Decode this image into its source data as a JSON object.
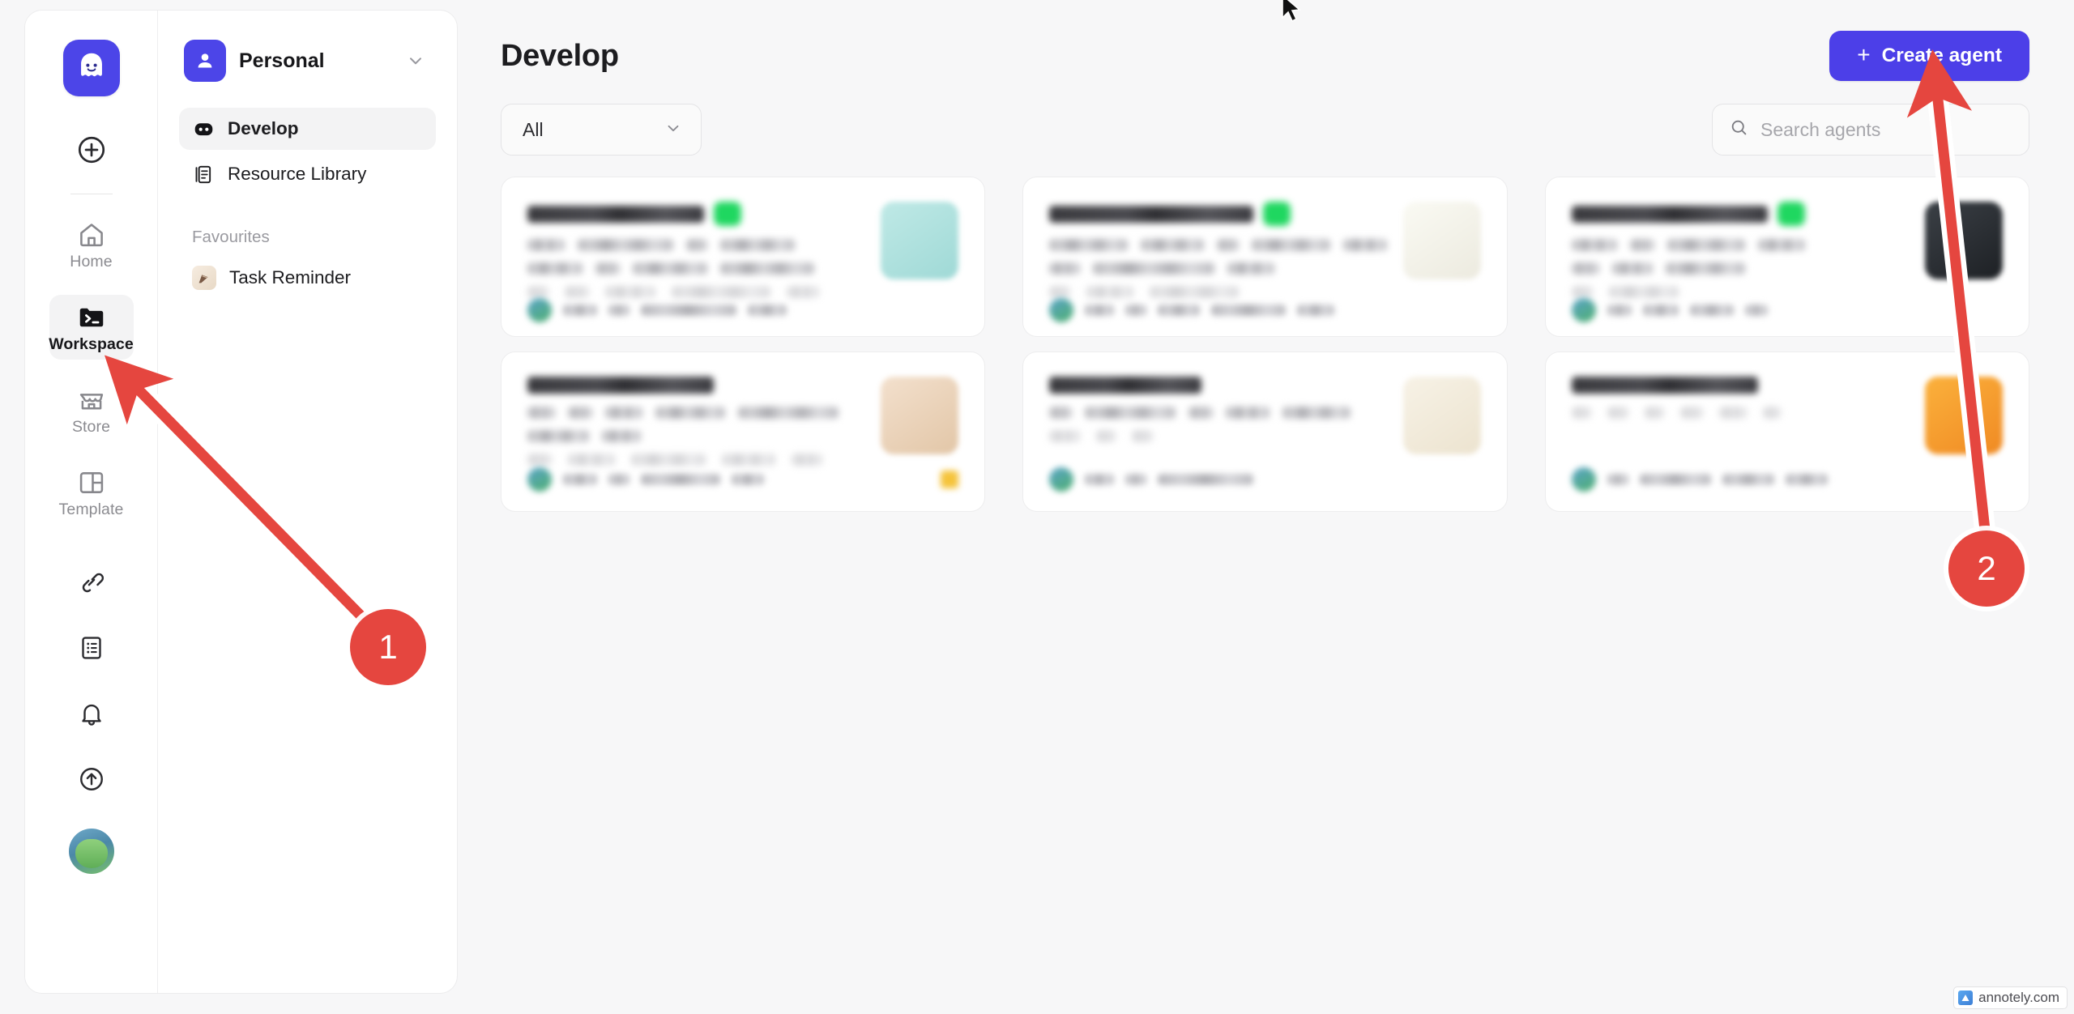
{
  "app": {
    "logo_icon": "ghost-mascot-logo",
    "brand_color": "#4c45e8"
  },
  "rail": {
    "add_icon": "plus-circle-icon",
    "items": [
      {
        "label": "Home",
        "icon": "home-icon",
        "active": false
      },
      {
        "label": "Workspace",
        "icon": "terminal-folder-icon",
        "active": true
      },
      {
        "label": "Store",
        "icon": "storefront-icon",
        "active": false
      },
      {
        "label": "Template",
        "icon": "layout-template-icon",
        "active": false
      }
    ],
    "mini_items": [
      {
        "icon": "plug-connection-icon",
        "label": "Integrations"
      },
      {
        "icon": "document-list-icon",
        "label": "Docs"
      },
      {
        "icon": "bell-icon",
        "label": "Notifications"
      },
      {
        "icon": "upload-circle-icon",
        "label": "Upload"
      }
    ],
    "avatar": "user-avatar"
  },
  "sidebar": {
    "workspace": {
      "name": "Personal",
      "avatar_icon": "person-icon",
      "chevron_icon": "chevron-down-icon"
    },
    "nav": [
      {
        "label": "Develop",
        "icon": "bot-face-icon",
        "active": true
      },
      {
        "label": "Resource Library",
        "icon": "book-document-icon",
        "active": false
      }
    ],
    "favourites_title": "Favourites",
    "favourites": [
      {
        "label": "Task Reminder",
        "icon": "task-reminder-thumb"
      }
    ]
  },
  "main": {
    "title": "Develop",
    "create_button": {
      "label": "Create agent",
      "plus": "+",
      "icon": "plus-icon",
      "color": "#4c3fe8"
    },
    "filter": {
      "value": "All",
      "chevron_icon": "chevron-down-icon"
    },
    "search": {
      "value": "",
      "placeholder": "Search agents",
      "icon": "search-icon"
    },
    "cards": [
      {
        "badge_color": "#1fd760",
        "thumb": "thumb-teal-photo",
        "title_w": 218,
        "lines": [
          [
            46,
            118,
            26,
            92
          ],
          [
            68,
            30,
            92,
            116
          ]
        ],
        "faint": [
          26,
          30,
          62,
          122,
          40
        ],
        "foot": [
          42,
          26,
          118,
          48
        ],
        "star": false
      },
      {
        "badge_color": "#1fd760",
        "thumb": "thumb-cream-sketch",
        "title_w": 252,
        "lines": [
          [
            108,
            86,
            30,
            108,
            60
          ],
          [
            38,
            150,
            58
          ]
        ],
        "faint": [
          26,
          58,
          110
        ],
        "foot": [
          36,
          26,
          52,
          92,
          46
        ],
        "star": false
      },
      {
        "badge_color": "#1fd760",
        "thumb": "thumb-dark-device",
        "title_w": 242,
        "lines": [
          [
            56,
            30,
            96,
            58
          ],
          [
            34,
            50,
            98
          ]
        ],
        "faint": [
          26,
          86
        ],
        "foot": [
          30,
          44,
          54,
          28
        ],
        "star": false
      },
      {
        "badge_color": null,
        "thumb": "thumb-tan-illustration",
        "title_w": 230,
        "lines": [
          [
            34,
            30,
            46,
            86,
            124
          ],
          [
            76,
            48
          ]
        ],
        "faint": [
          30,
          58,
          92,
          66,
          38
        ],
        "foot": [
          42,
          26,
          98,
          40
        ],
        "star": true
      },
      {
        "badge_color": null,
        "thumb": "thumb-cream-numeral",
        "title_w": 188,
        "lines": [
          [
            28,
            112,
            30,
            54,
            84
          ],
          []
        ],
        "faint": [
          38,
          24,
          26
        ],
        "foot": [
          36,
          26,
          118
        ],
        "star": false
      },
      {
        "badge_color": null,
        "thumb": "thumb-orange-app",
        "title_w": 230,
        "lines": [
          [],
          []
        ],
        "faint": [
          24,
          26,
          24,
          28,
          34,
          22
        ],
        "foot": [
          26,
          88,
          64,
          52
        ],
        "star": false
      }
    ]
  },
  "annotations": {
    "markers": [
      {
        "number": "1",
        "color": "#e5463f",
        "points_to": "Workspace rail item"
      },
      {
        "number": "2",
        "color": "#e5463f",
        "points_to": "Create agent button"
      }
    ]
  },
  "watermark": {
    "text": "annotely.com",
    "icon": "annotely-logo-icon"
  }
}
